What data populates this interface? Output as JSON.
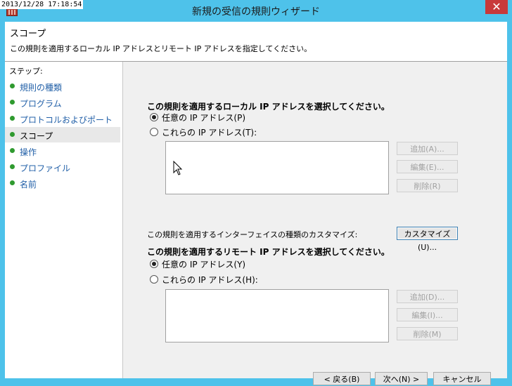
{
  "timestamp": "2013/12/28 17:18:54",
  "window": {
    "title": "新規の受信の規則ウィザード",
    "close": "✕"
  },
  "header": {
    "title": "スコープ",
    "description": "この規則を適用するローカル IP アドレスとリモート IP アドレスを指定してください。"
  },
  "steps": {
    "title": "ステップ:",
    "items": [
      {
        "label": "規則の種類"
      },
      {
        "label": "プログラム"
      },
      {
        "label": "プロトコルおよびポート"
      },
      {
        "label": "スコープ",
        "current": true
      },
      {
        "label": "操作"
      },
      {
        "label": "プロファイル"
      },
      {
        "label": "名前"
      }
    ]
  },
  "local": {
    "title": "この規則を適用するローカル IP アドレスを選択してください。",
    "any_label": "任意の IP アドレス(P)",
    "these_label": "これらの IP アドレス(T):",
    "selected": "any",
    "add": "追加(A)...",
    "edit": "編集(E)...",
    "remove": "削除(R)"
  },
  "customize": {
    "label": "この規則を適用するインターフェイスの種類のカスタマイズ:",
    "button": "カスタマイズ(U)..."
  },
  "remote": {
    "title": "この規則を適用するリモート IP アドレスを選択してください。",
    "any_label": "任意の IP アドレス(Y)",
    "these_label": "これらの IP アドレス(H):",
    "selected": "any",
    "add": "追加(D)...",
    "edit": "編集(I)...",
    "remove": "削除(M)"
  },
  "footer": {
    "back": "< 戻る(B)",
    "next": "次へ(N) >",
    "cancel": "キャンセル"
  },
  "colors": {
    "titlebar": "#4ec2ea",
    "step_link": "#2260a8",
    "step_dot": "#2f9a2f"
  }
}
